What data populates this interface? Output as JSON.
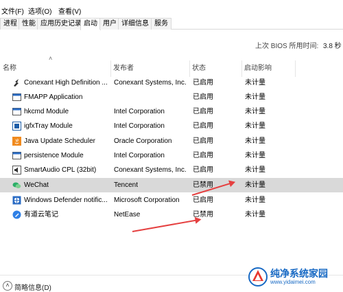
{
  "menu": {
    "file": "文件(F)",
    "options": "选项(O)",
    "view": "查看(V)"
  },
  "tabs": [
    {
      "label": "进程"
    },
    {
      "label": "性能"
    },
    {
      "label": "应用历史记录"
    },
    {
      "label": "启动",
      "active": true
    },
    {
      "label": "用户"
    },
    {
      "label": "详细信息"
    },
    {
      "label": "服务"
    }
  ],
  "bios": {
    "label": "上次 BIOS 所用时间:",
    "value": "3.8 秒"
  },
  "columns": {
    "name": "名称",
    "publisher": "发布者",
    "status": "状态",
    "impact": "启动影响"
  },
  "rows": [
    {
      "name": "Conexant High Definition ...",
      "publisher": "Conexant Systems, Inc.",
      "status": "已启用",
      "impact": "未计量",
      "icon": "conexant-icon"
    },
    {
      "name": "FMAPP Application",
      "publisher": "",
      "status": "已启用",
      "impact": "未计量",
      "icon": "generic-app-icon"
    },
    {
      "name": "hkcmd Module",
      "publisher": "Intel Corporation",
      "status": "已启用",
      "impact": "未计量",
      "icon": "generic-app-icon"
    },
    {
      "name": "igfxTray Module",
      "publisher": "Intel Corporation",
      "status": "已启用",
      "impact": "未计量",
      "icon": "intel-graphics-icon"
    },
    {
      "name": "Java Update Scheduler",
      "publisher": "Oracle Corporation",
      "status": "已启用",
      "impact": "未计量",
      "icon": "java-icon"
    },
    {
      "name": "persistence Module",
      "publisher": "Intel Corporation",
      "status": "已启用",
      "impact": "未计量",
      "icon": "generic-app-icon"
    },
    {
      "name": "SmartAudio CPL (32bit)",
      "publisher": "Conexant Systems, Inc.",
      "status": "已启用",
      "impact": "未计量",
      "icon": "audio-icon"
    },
    {
      "name": "WeChat",
      "publisher": "Tencent",
      "status": "已禁用",
      "impact": "未计量",
      "icon": "wechat-icon",
      "selected": true
    },
    {
      "name": "Windows Defender notific...",
      "publisher": "Microsoft Corporation",
      "status": "已启用",
      "impact": "未计量",
      "icon": "defender-icon"
    },
    {
      "name": "有道云笔记",
      "publisher": "NetEase",
      "status": "已禁用",
      "impact": "未计量",
      "icon": "youdao-note-icon"
    }
  ],
  "footer": {
    "label": "简略信息(D)"
  },
  "watermark": {
    "title": "纯净系统家园",
    "url": "www.yidaimei.com"
  },
  "colors": {
    "selected_row": "#d9d9d9",
    "annotation_arrow": "#e54040",
    "watermark_blue": "#1769c4"
  }
}
